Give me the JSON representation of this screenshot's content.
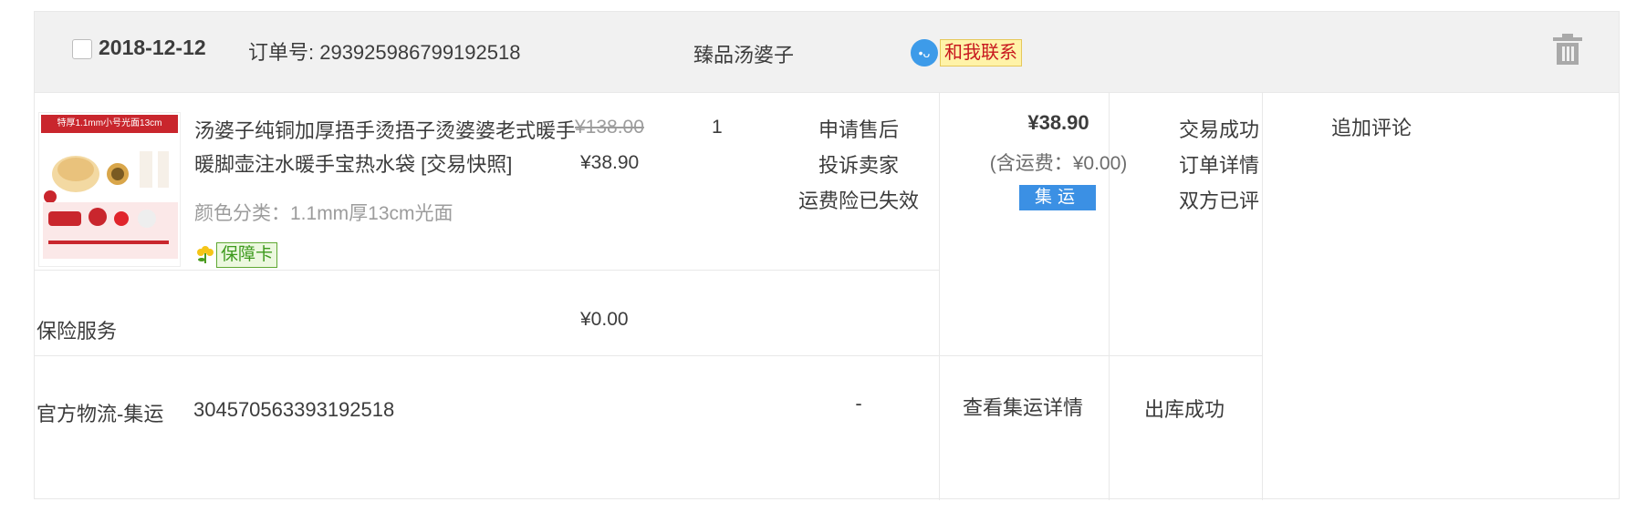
{
  "order": {
    "date": "2018-12-12",
    "order_no_label": "订单号: 293925986799192518",
    "shop_name": "臻品汤婆子",
    "contact_label": "和我联系"
  },
  "product": {
    "thumbnail_banner": "特厚1.1mm小号光面13cm",
    "name": "汤婆子纯铜加厚捂手烫捂子烫婆婆老式暖手暖脚壶注水暖手宝热水袋 [交易快照]",
    "variant": "颜色分类：1.1mm厚13cm光面",
    "guarantee_label": "保障卡",
    "original_price": "¥138.00",
    "price": "¥38.90",
    "quantity": "1"
  },
  "operations": [
    "申请售后",
    "投诉卖家",
    "运费险已失效"
  ],
  "payment": {
    "total": "¥38.90",
    "shipping_fee": "(含运费：¥0.00)",
    "badge": "集运"
  },
  "status_links": [
    "交易成功",
    "订单详情",
    "双方已评"
  ],
  "review_action": "追加评论",
  "insurance": {
    "label": "保险服务",
    "price": "¥0.00"
  },
  "logistics": {
    "label": "官方物流-集运",
    "tracking_no": "304570563393192518",
    "dash": "-",
    "detail_link": "查看集运详情",
    "status": "出库成功"
  },
  "icons": {
    "checkbox": "checkbox-icon",
    "contact": "chat-bubble-icon",
    "delete": "trash-icon",
    "guarantee": "flower-icon"
  },
  "colors": {
    "header_bg": "#f1f1f1",
    "badge_blue": "#3b90e4",
    "contact_red": "#c8181e",
    "guarantee_green": "#3d9a1d"
  }
}
